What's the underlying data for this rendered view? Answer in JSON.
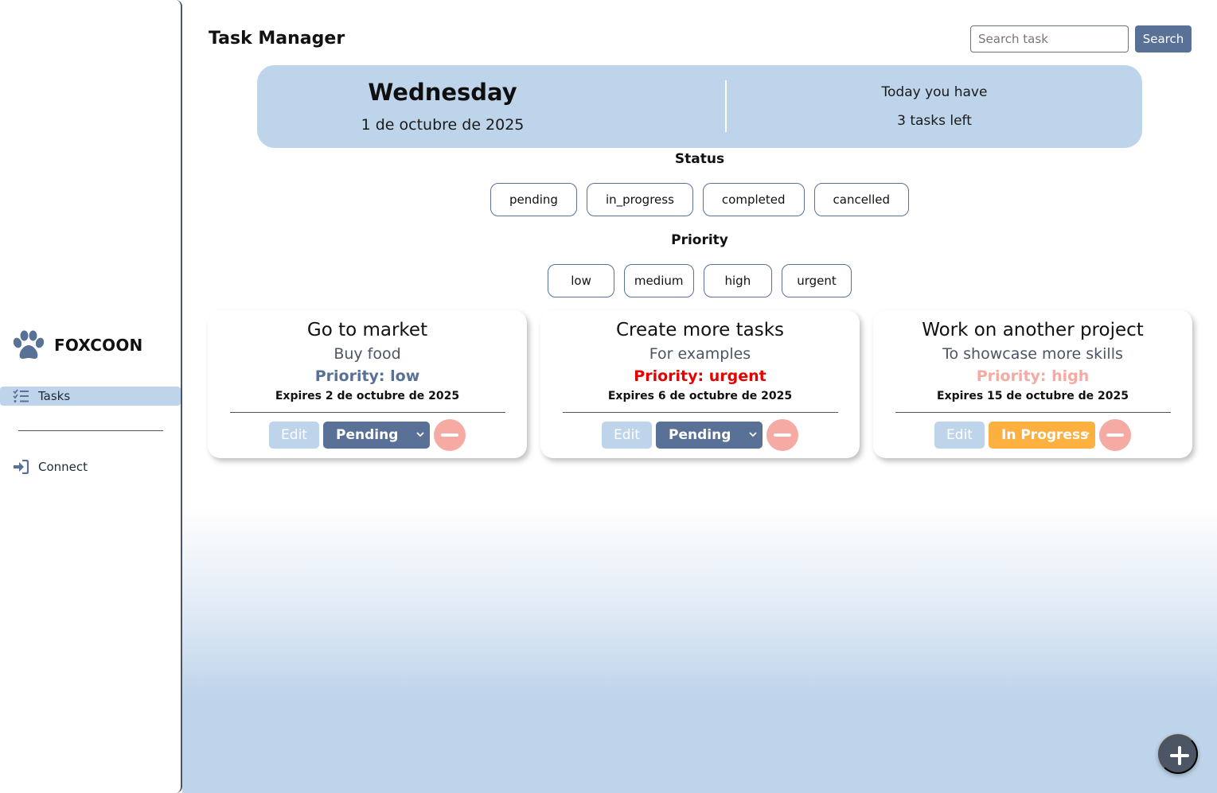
{
  "sidebar": {
    "brand": "FOXCOON",
    "nav": [
      {
        "label": "Tasks",
        "icon": "list-check-icon",
        "active": true
      },
      {
        "label": "Connect",
        "icon": "sign-in-icon",
        "active": false
      }
    ]
  },
  "header": {
    "title": "Task Manager",
    "search_placeholder": "Search task",
    "search_label": "Search"
  },
  "today": {
    "day": "Wednesday",
    "date": "1 de octubre de 2025",
    "line1": "Today you have",
    "line2": "3 tasks left"
  },
  "filters": {
    "status_title": "Status",
    "status": [
      "pending",
      "in_progress",
      "completed",
      "cancelled"
    ],
    "priority_title": "Priority",
    "priority": [
      "low",
      "medium",
      "high",
      "urgent"
    ]
  },
  "tasks": [
    {
      "title": "Go to market",
      "description": "Buy food",
      "priority": "Priority: low",
      "priority_color": "#5a7197",
      "expires": "Expires 2 de octubre de 2025",
      "edit_label": "Edit",
      "status": "Pending",
      "status_color": "#5a7197"
    },
    {
      "title": "Create more tasks",
      "description": "For examples",
      "priority": "Priority: urgent",
      "priority_color": "#e60000",
      "expires": "Expires 6 de octubre de 2025",
      "edit_label": "Edit",
      "status": "Pending",
      "status_color": "#5a7197"
    },
    {
      "title": "Work on another project",
      "description": "To showcase more skills",
      "priority": "Priority: high",
      "priority_color": "#f5aaa4",
      "expires": "Expires 15 de octubre de 2025",
      "edit_label": "Edit",
      "status": "In Progress",
      "status_color": "#fbb040"
    }
  ],
  "colors": {
    "accent": "#5a7197",
    "banner": "#bed4ea",
    "delete": "#f5aaa4",
    "fab": "#4b5563"
  }
}
